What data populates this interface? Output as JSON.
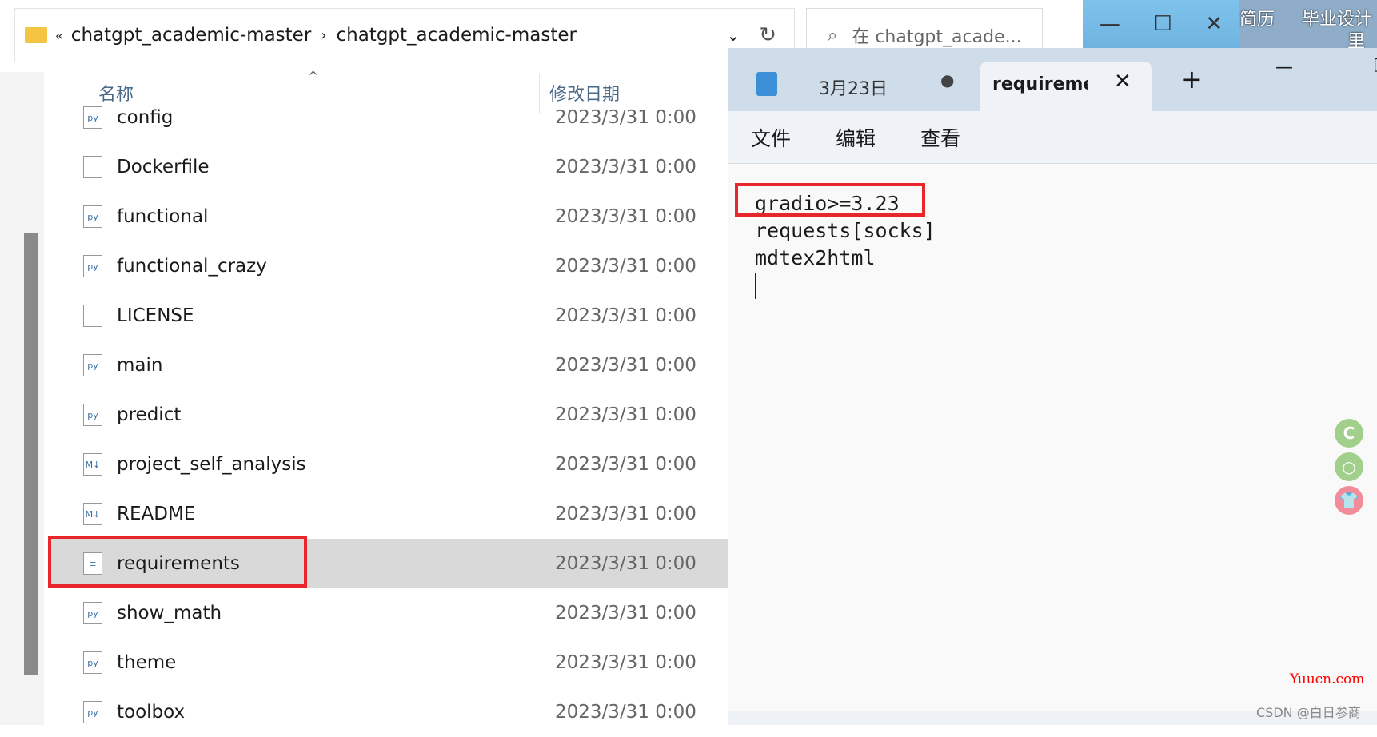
{
  "explorer": {
    "breadcrumb": [
      "chatgpt_academic-master",
      "chatgpt_academic-master"
    ],
    "search_placeholder": "在 chatgpt_acade...",
    "col_name": "名称",
    "col_date": "修改日期",
    "files": [
      {
        "name": "config",
        "date": "2023/3/31 0:00",
        "icon": "python-file-icon"
      },
      {
        "name": "Dockerfile",
        "date": "2023/3/31 0:00",
        "icon": "file-icon"
      },
      {
        "name": "functional",
        "date": "2023/3/31 0:00",
        "icon": "python-file-icon"
      },
      {
        "name": "functional_crazy",
        "date": "2023/3/31 0:00",
        "icon": "python-file-icon"
      },
      {
        "name": "LICENSE",
        "date": "2023/3/31 0:00",
        "icon": "file-icon"
      },
      {
        "name": "main",
        "date": "2023/3/31 0:00",
        "icon": "python-file-icon"
      },
      {
        "name": "predict",
        "date": "2023/3/31 0:00",
        "icon": "python-file-icon"
      },
      {
        "name": "project_self_analysis",
        "date": "2023/3/31 0:00",
        "icon": "markdown-file-icon"
      },
      {
        "name": "README",
        "date": "2023/3/31 0:00",
        "icon": "markdown-file-icon"
      },
      {
        "name": "requirements",
        "date": "2023/3/31 0:00",
        "icon": "text-file-icon",
        "selected": true
      },
      {
        "name": "show_math",
        "date": "2023/3/31 0:00",
        "icon": "python-file-icon"
      },
      {
        "name": "theme",
        "date": "2023/3/31 0:00",
        "icon": "python-file-icon"
      },
      {
        "name": "toolbox",
        "date": "2023/3/31 0:00",
        "icon": "python-file-icon"
      }
    ]
  },
  "desktop": {
    "item1": "简历",
    "item2": "毕业设计",
    "item3": "里"
  },
  "notepad": {
    "tabs": [
      "3月23日",
      "requiremei"
    ],
    "menu": [
      "文件",
      "编辑",
      "查看"
    ],
    "lines": [
      "gradio>=3.23",
      "requests[socks]",
      "mdtex2html"
    ]
  },
  "watermark": {
    "site": "Yuucn.com",
    "csdn": "CSDN @白日参商"
  },
  "colors": {
    "highlight": "#e8262c",
    "selection": "#d9d9d9"
  }
}
